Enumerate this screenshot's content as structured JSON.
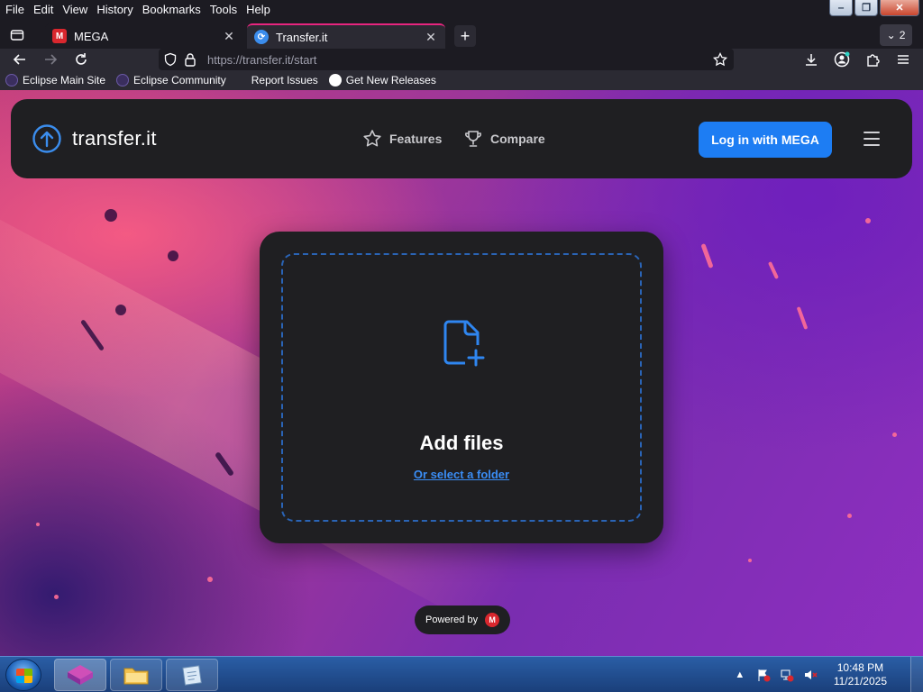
{
  "menubar": {
    "items": [
      "File",
      "Edit",
      "View",
      "History",
      "Bookmarks",
      "Tools",
      "Help"
    ]
  },
  "tabs": [
    {
      "title": "MEGA",
      "favicon": "mega-favicon"
    },
    {
      "title": "Transfer.it",
      "favicon": "transfer-favicon",
      "active": true
    }
  ],
  "tab_count": "2",
  "urlbar": {
    "url": "https://transfer.it/start"
  },
  "bookmarks": [
    {
      "label": "Eclipse Main Site",
      "icon": "eclipse-icon"
    },
    {
      "label": "Eclipse Community",
      "icon": "eclipse-icon"
    },
    {
      "label": "Report Issues",
      "icon": "none"
    },
    {
      "label": "Get New Releases",
      "icon": "github-icon"
    }
  ],
  "site": {
    "logo_text": "transfer.it",
    "nav": [
      {
        "label": "Features",
        "icon": "star-icon"
      },
      {
        "label": "Compare",
        "icon": "trophy-icon"
      }
    ],
    "login_label": "Log in with MEGA",
    "upload": {
      "title": "Add files",
      "folder_link": "Or select a folder"
    },
    "powered_by": "Powered by",
    "colors": {
      "accent": "#1d7df3",
      "card": "#1f1f22",
      "mega_red": "#d9272e"
    }
  },
  "taskbar": {
    "clock_time": "10:48 PM",
    "clock_date": "11/21/2025"
  }
}
